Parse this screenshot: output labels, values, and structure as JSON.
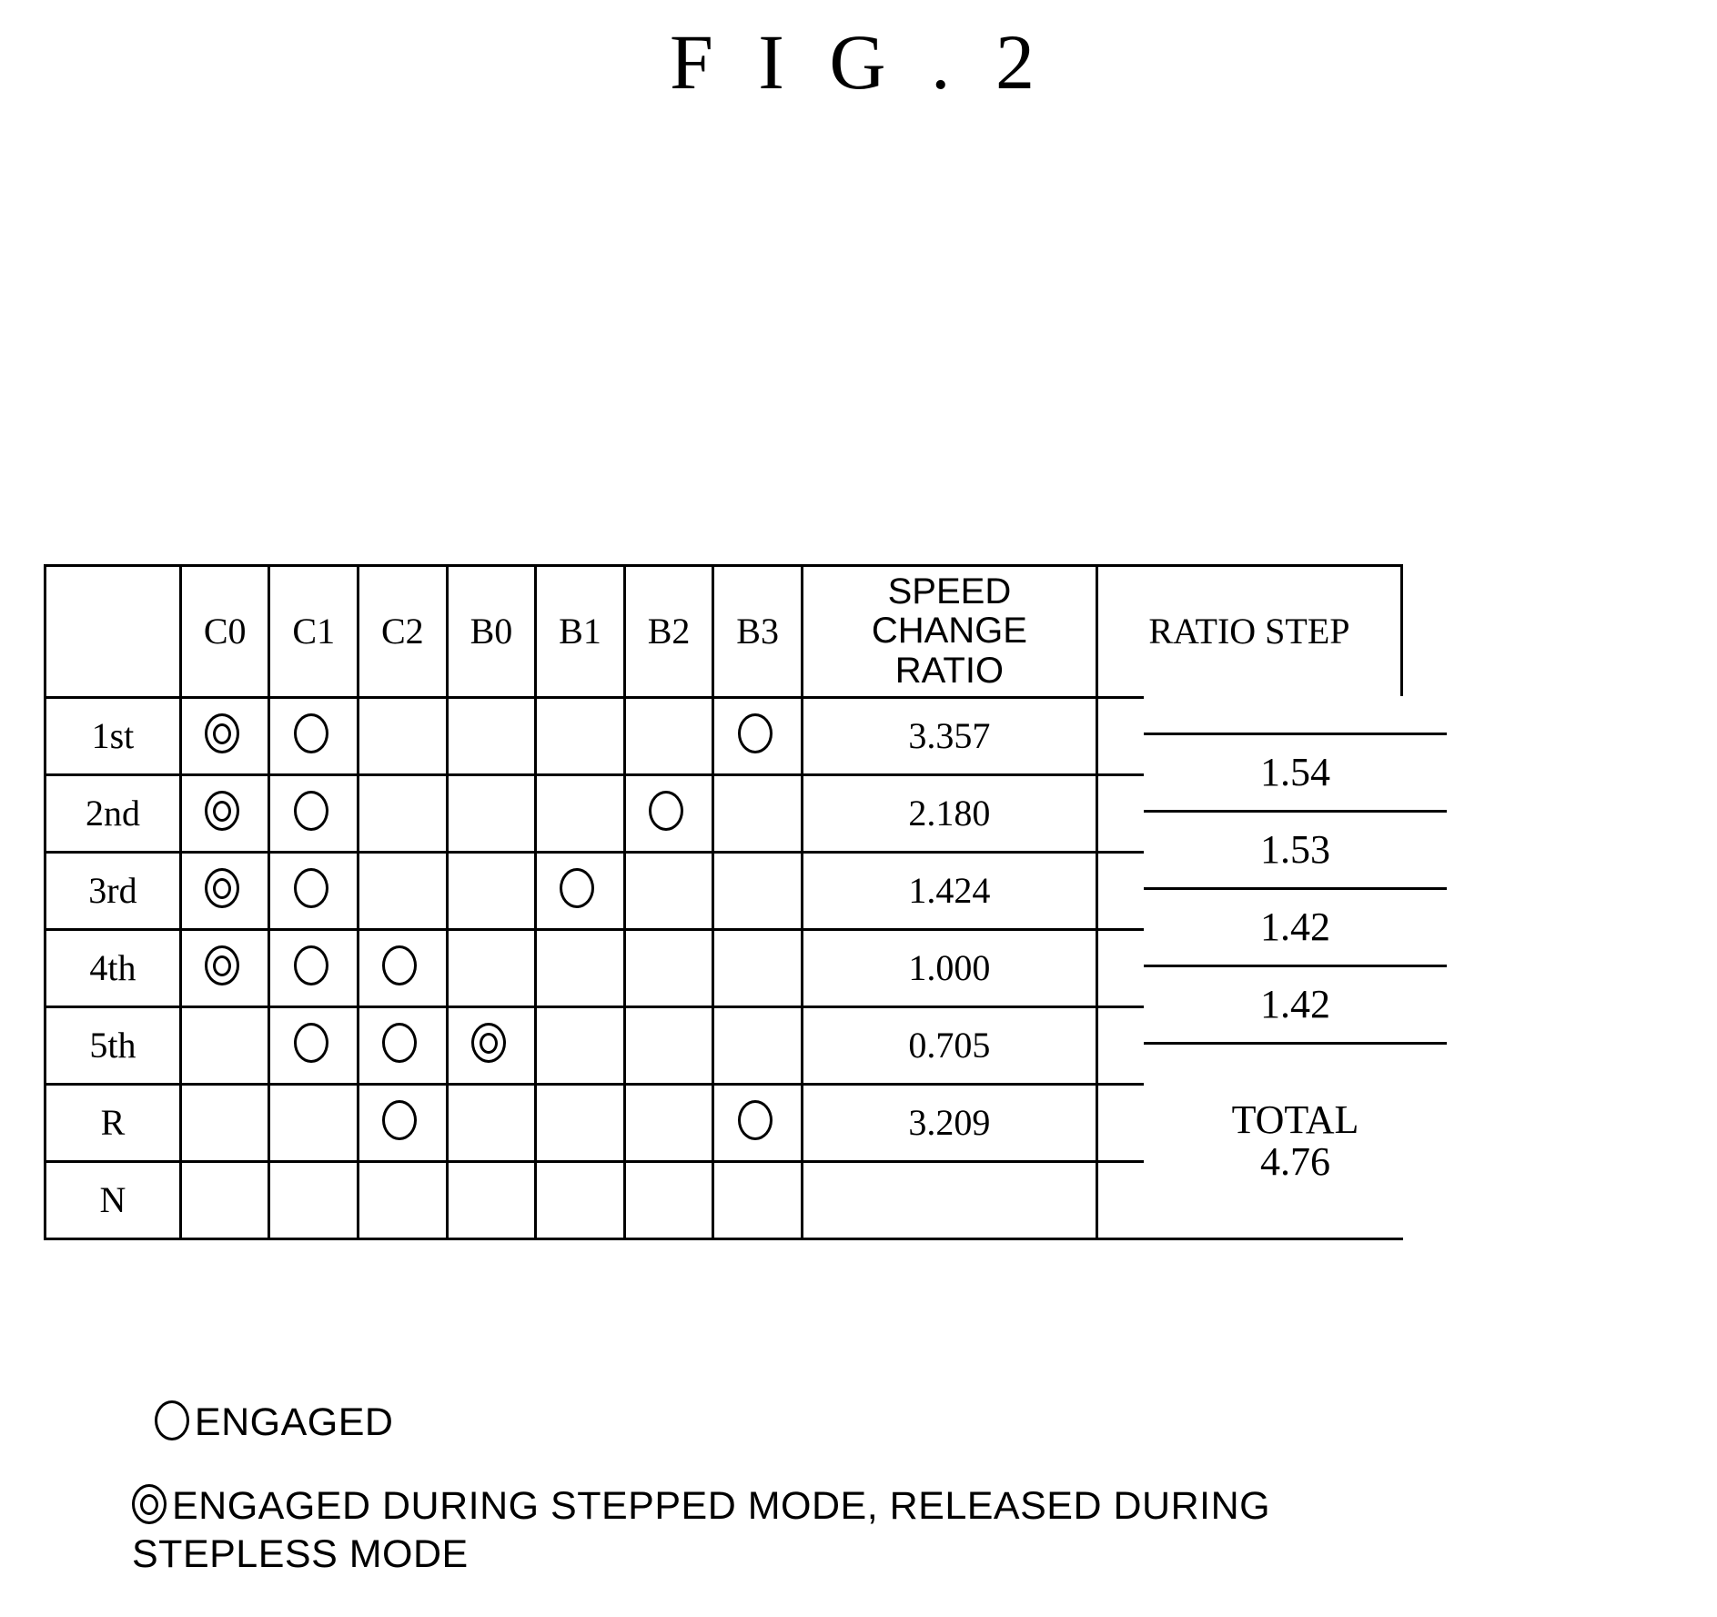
{
  "figure": {
    "title": "F I G . 2"
  },
  "table": {
    "columns": {
      "gear": "",
      "elements": [
        "C0",
        "C1",
        "C2",
        "B0",
        "B1",
        "B2",
        "B3"
      ],
      "speed_change_ratio": "SPEED\nCHANGE\nRATIO",
      "speed_change_ratio_lines": [
        "SPEED",
        "CHANGE",
        "RATIO"
      ],
      "ratio_step": "RATIO STEP"
    },
    "rows": [
      {
        "gear": "1st",
        "marks": [
          "double",
          "single",
          "",
          "",
          "",
          "",
          "single"
        ],
        "ratio": "3.357"
      },
      {
        "gear": "2nd",
        "marks": [
          "double",
          "single",
          "",
          "",
          "",
          "single",
          ""
        ],
        "ratio": "2.180"
      },
      {
        "gear": "3rd",
        "marks": [
          "double",
          "single",
          "",
          "",
          "single",
          "",
          ""
        ],
        "ratio": "1.424"
      },
      {
        "gear": "4th",
        "marks": [
          "double",
          "single",
          "single",
          "",
          "",
          "",
          ""
        ],
        "ratio": "1.000"
      },
      {
        "gear": "5th",
        "marks": [
          "",
          "single",
          "single",
          "double",
          "",
          "",
          ""
        ],
        "ratio": "0.705"
      },
      {
        "gear": "R",
        "marks": [
          "",
          "",
          "single",
          "",
          "",
          "",
          "single"
        ],
        "ratio": "3.209"
      },
      {
        "gear": "N",
        "marks": [
          "",
          "",
          "",
          "",
          "",
          "",
          ""
        ],
        "ratio": ""
      }
    ],
    "ratio_steps": [
      "1.54",
      "1.53",
      "1.42",
      "1.42"
    ],
    "total_label": "TOTAL",
    "total_value": "4.76"
  },
  "legend": {
    "single_circle_text": "ENGAGED",
    "double_circle_text": "ENGAGED DURING STEPPED MODE, RELEASED DURING STEPLESS MODE"
  },
  "colors": {
    "ink": "#000000",
    "paper": "#ffffff"
  }
}
